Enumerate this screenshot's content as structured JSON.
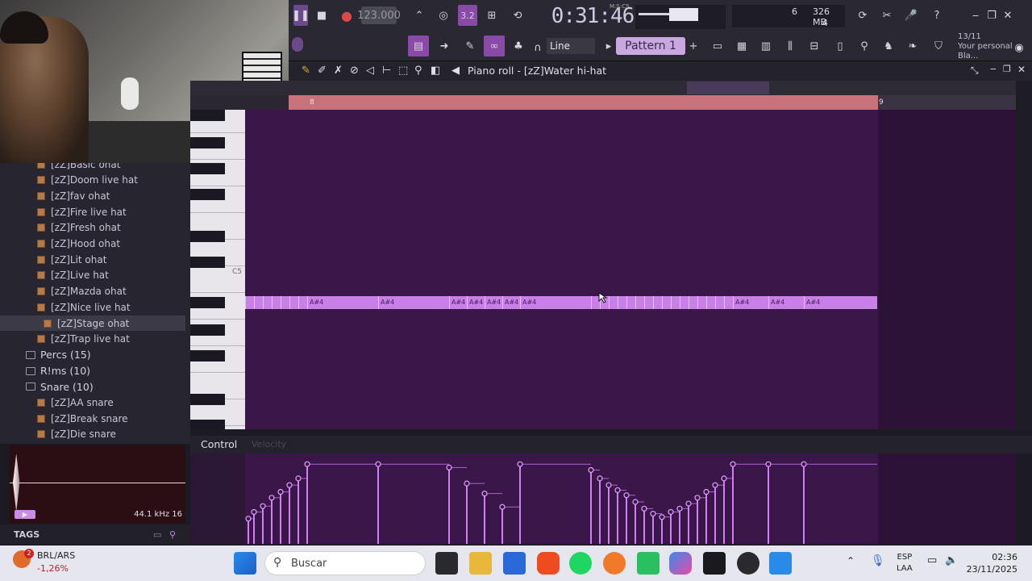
{
  "toolbar": {
    "tempo": "123.000",
    "time_display": "0:31:46",
    "time_mode": "M:S:CS",
    "pattern_label": "Pattern 1",
    "snap_label": "Line",
    "cpu_voices": "6",
    "cpu_mem": "326 MB",
    "cpu_poly": "4",
    "news_counter": "13/11",
    "news_text": "Your personal Bla..."
  },
  "piano_roll": {
    "title": "Piano roll - [zZ]Water hi-hat",
    "bar_start": "8",
    "bar_end": "9",
    "c5_label": "C5",
    "note_label": "A#4"
  },
  "browser": {
    "items": [
      {
        "label": "[zZ]Basic ohat",
        "kind": "file"
      },
      {
        "label": "[zZ]Doom live hat",
        "kind": "file"
      },
      {
        "label": "[zZ]fav ohat",
        "kind": "file"
      },
      {
        "label": "[zZ]Fire live hat",
        "kind": "file"
      },
      {
        "label": "[zZ]Fresh ohat",
        "kind": "file"
      },
      {
        "label": "[zZ]Hood ohat",
        "kind": "file"
      },
      {
        "label": "[zZ]Lit ohat",
        "kind": "file"
      },
      {
        "label": "[zZ]Live hat",
        "kind": "file"
      },
      {
        "label": "[zZ]Mazda ohat",
        "kind": "file"
      },
      {
        "label": "[zZ]Nice live hat",
        "kind": "file"
      },
      {
        "label": "[zZ]Stage ohat",
        "kind": "file",
        "selected": true
      },
      {
        "label": "[zZ]Trap live hat",
        "kind": "file"
      },
      {
        "label": "Percs (15)",
        "kind": "folder"
      },
      {
        "label": "R!ms (10)",
        "kind": "folder"
      },
      {
        "label": "Snare (10)",
        "kind": "folder"
      },
      {
        "label": "[zZ]AA snare",
        "kind": "file"
      },
      {
        "label": "[zZ]Break snare",
        "kind": "file"
      },
      {
        "label": "[zZ]Die snare",
        "kind": "file"
      }
    ],
    "sample_rate": "44.1 kHz 16",
    "tags_label": "TAGS"
  },
  "control": {
    "label": "Control",
    "param": "Velocity"
  },
  "taskbar": {
    "ticker": "BRL/ARS",
    "ticker_change": "-1,26%",
    "ticker_badge": "2",
    "search_placeholder": "Buscar",
    "lang": "ESP",
    "lang_sub": "LAA",
    "time": "02:36",
    "date": "23/11/2025"
  },
  "colors": {
    "note": "#c880e8",
    "grid_bg": "#3a1748",
    "loop_bar": "#c8727c",
    "pattern_bg": "#c9a8e0"
  }
}
